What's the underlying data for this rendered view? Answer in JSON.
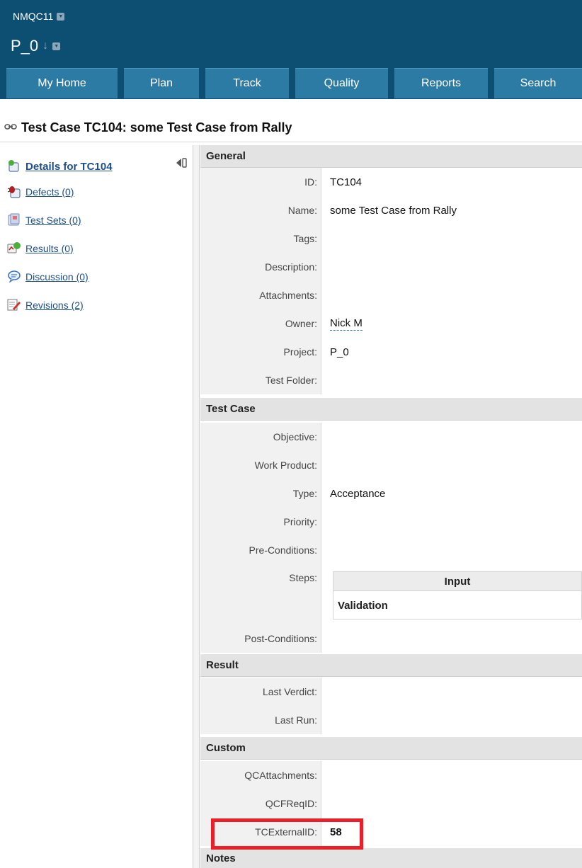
{
  "header": {
    "workspace": "NMQC11",
    "project": "P_0",
    "tabs": [
      {
        "label": "My Home"
      },
      {
        "label": "Plan"
      },
      {
        "label": "Track"
      },
      {
        "label": "Quality"
      },
      {
        "label": "Reports"
      },
      {
        "label": "Search"
      }
    ]
  },
  "page": {
    "title": "Test Case TC104: some Test Case from Rally"
  },
  "nav": {
    "items": [
      {
        "label": "Details for TC104",
        "icon": "details-icon"
      },
      {
        "label": "Defects (0)",
        "icon": "bug-icon"
      },
      {
        "label": "Test Sets (0)",
        "icon": "test-set-icon"
      },
      {
        "label": "Results (0)",
        "icon": "results-icon"
      },
      {
        "label": "Discussion (0)",
        "icon": "discussion-icon"
      },
      {
        "label": "Revisions (2)",
        "icon": "revisions-icon"
      }
    ]
  },
  "details": {
    "general": {
      "header": "General",
      "fields": [
        {
          "label": "ID:",
          "value": "TC104"
        },
        {
          "label": "Name:",
          "value": "some Test Case from Rally"
        },
        {
          "label": "Tags:",
          "value": ""
        },
        {
          "label": "Description:",
          "value": ""
        },
        {
          "label": "Attachments:",
          "value": ""
        },
        {
          "label": "Owner:",
          "value": "Nick M"
        },
        {
          "label": "Project:",
          "value": "P_0"
        },
        {
          "label": "Test Folder:",
          "value": ""
        }
      ]
    },
    "test_case": {
      "header": "Test Case",
      "fields": [
        {
          "label": "Objective:",
          "value": ""
        },
        {
          "label": "Work Product:",
          "value": ""
        },
        {
          "label": "Type:",
          "value": "Acceptance"
        },
        {
          "label": "Priority:",
          "value": ""
        },
        {
          "label": "Pre-Conditions:",
          "value": ""
        },
        {
          "label": "Steps:",
          "value": ""
        },
        {
          "label": "Post-Conditions:",
          "value": ""
        }
      ],
      "steps_table": {
        "column": "Input",
        "row": "Validation"
      }
    },
    "result": {
      "header": "Result",
      "fields": [
        {
          "label": "Last Verdict:",
          "value": ""
        },
        {
          "label": "Last Run:",
          "value": ""
        }
      ]
    },
    "custom": {
      "header": "Custom",
      "fields": [
        {
          "label": "QCAttachments:",
          "value": ""
        },
        {
          "label": "QCFReqID:",
          "value": ""
        },
        {
          "label": "TCExternalID:",
          "value": "58"
        }
      ]
    },
    "notes": {
      "header": "Notes"
    }
  },
  "colors": {
    "header_bg": "#0d4f73",
    "tab_bg": "#2c7ba5",
    "link": "#1e4e8c",
    "section_bg": "#e3e3e3",
    "highlight": "#e8202a"
  }
}
